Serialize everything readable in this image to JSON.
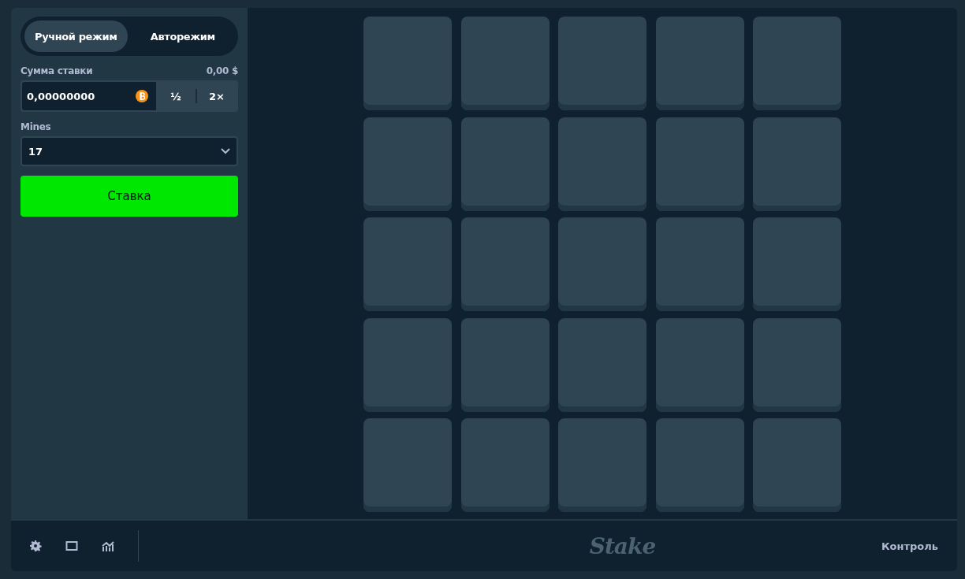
{
  "mode_tabs": [
    {
      "label": "Ручной режим",
      "selected": true
    },
    {
      "label": "Авторежим",
      "selected": false
    }
  ],
  "bet": {
    "label": "Сумма ставки",
    "converted": "0,00 $",
    "value": "0,00000000",
    "buttons": [
      "½",
      "2×"
    ]
  },
  "mines": {
    "label": "Mines",
    "value": "17"
  },
  "bet_button": "Ставка",
  "tiles": [
    {
      "kind": "hidden"
    },
    {
      "kind": "hidden"
    },
    {
      "kind": "hidden"
    },
    {
      "kind": "hidden"
    },
    {
      "kind": "hidden"
    },
    {
      "kind": "hidden"
    },
    {
      "kind": "hidden"
    },
    {
      "kind": "hidden"
    },
    {
      "kind": "hidden"
    },
    {
      "kind": "hidden"
    },
    {
      "kind": "hidden"
    },
    {
      "kind": "hidden"
    },
    {
      "kind": "hidden"
    },
    {
      "kind": "hidden"
    },
    {
      "kind": "hidden"
    },
    {
      "kind": "hidden"
    },
    {
      "kind": "hidden"
    },
    {
      "kind": "hidden"
    },
    {
      "kind": "hidden"
    },
    {
      "kind": "hidden"
    },
    {
      "kind": "hidden"
    },
    {
      "kind": "hidden"
    },
    {
      "kind": "hidden"
    },
    {
      "kind": "hidden"
    },
    {
      "kind": "hidden"
    }
  ],
  "footer": {
    "logo": "Stake",
    "control": "Контроль"
  }
}
